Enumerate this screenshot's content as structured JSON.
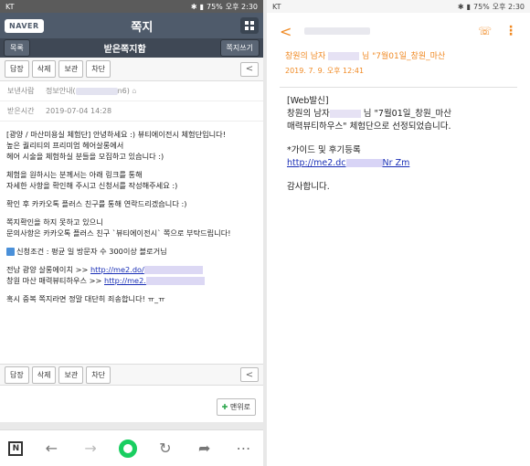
{
  "left": {
    "status": {
      "carrier": "KT",
      "battery": "75%",
      "time": "오후 2:30"
    },
    "header": {
      "logo": "NAVER",
      "title": "쪽지"
    },
    "subbar": {
      "back": "목록",
      "title": "받은쪽지함",
      "compose": "쪽지쓰기"
    },
    "actions": [
      "답장",
      "삭제",
      "보관",
      "차단"
    ],
    "meta": {
      "sender_label": "보낸사람",
      "sender_value_prefix": "정보안내(",
      "sender_value_suffix": "n6)",
      "received_label": "받은시간",
      "received_value": "2019-07-04 14:28"
    },
    "body": {
      "p1": "[광양 / 마산미용실 체험단] 안녕하세요 :) 뷰티에이전시 체험단입니다!\n높은 퀄리티의 프리미엄 헤어살롱에서\n헤어 시술을 체험하실 분들을 모집하고 있습니다 :)",
      "p2": "체험을 원하시는 분께서는 아래 링크를 통해\n자세한 사항을 확인해 주시고 신청서를 작성해주세요 :)",
      "p3": "확인 후 카카오톡 플러스 친구를 통해 연락드리겠습니다 :)",
      "p4": "쪽지확인을 하지 못하고 있으니\n문의사항은 카카오톡 플러스 친구 `뷰티에이전시` 쪽으로 부탁드립니다!",
      "p5": "신청조건 : 평균 일 방문자 수 300이상 블로거님",
      "line_gwangyang": "전남 광양 살롱에이치 >> ",
      "link_gwangyang": "http://me2.do/",
      "line_masan": "창원 마산 매력뷰티하우스 >> ",
      "link_masan": "http://me2.",
      "p7": "혹시 중복 쪽지라면 정말 대단히 죄송합니다! ㅠ_ㅠ"
    },
    "top_button": "맨위로"
  },
  "right": {
    "status": {
      "carrier": "KT",
      "battery": "75%",
      "time": "오후 2:30"
    },
    "title_prefix": "창원의 남자",
    "title_suffix": "님 \"7월01일_창원_마산",
    "date": "2019. 7. 9. 오후 12:41",
    "body": {
      "line1": "[Web발신]",
      "line2_prefix": "창원의 남자",
      "line2_suffix": "님 \"7월01일_창원_마산",
      "line3": "매력뷰티하우스\" 체험단으로 선정되었습니다.",
      "guide": "*가이드 및 후기등록",
      "link_prefix": "http://me2.dc",
      "link_suffix": "Nr Zm",
      "thanks": "감사합니다."
    }
  },
  "colors": {
    "naver_header": "#4f5b6b",
    "accent_orange": "#f08a24",
    "link_blue": "#1a2fb6",
    "green": "#19ce60"
  }
}
